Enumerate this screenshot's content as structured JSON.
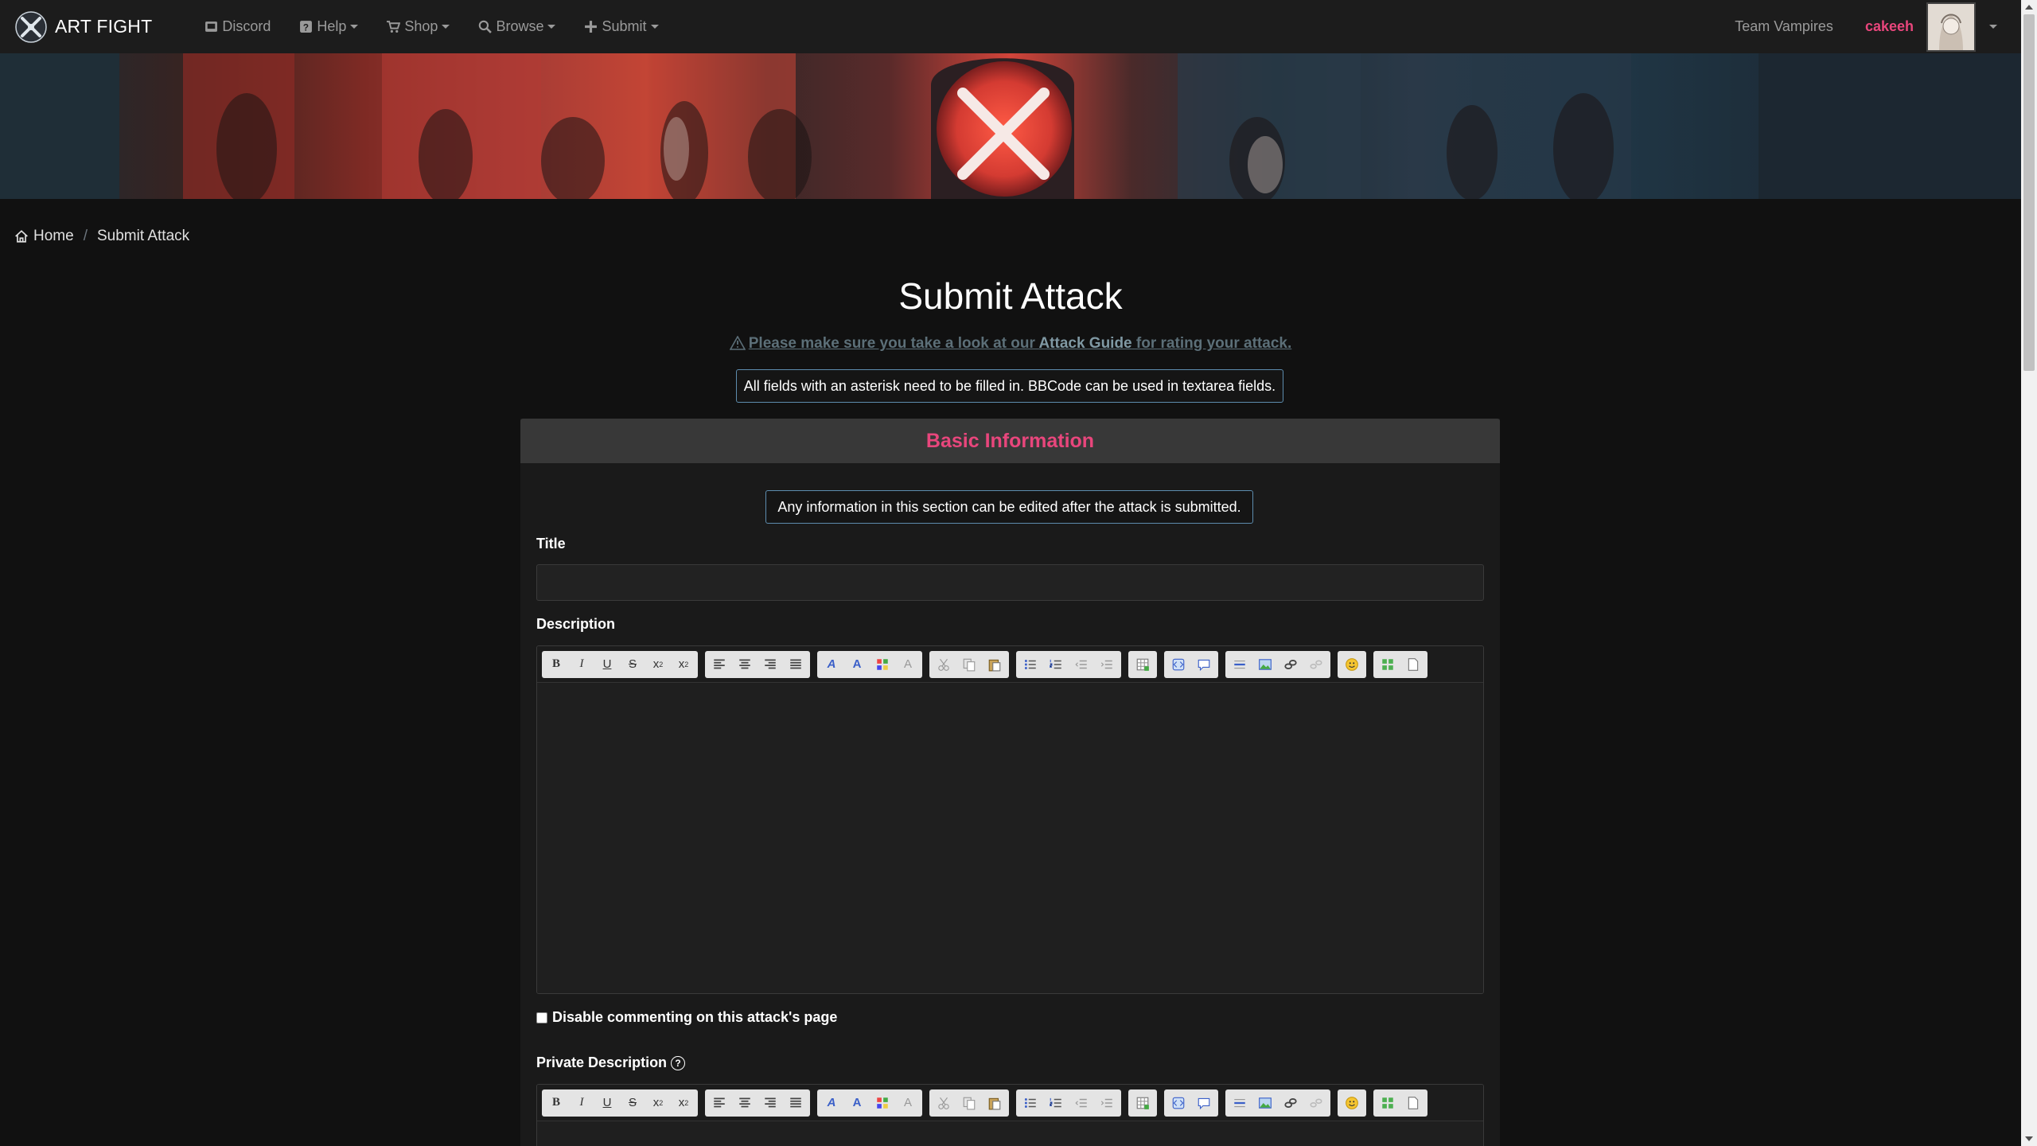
{
  "nav": {
    "brand": "ART FIGHT",
    "items": [
      {
        "label": "Discord",
        "icon": "discord-icon",
        "dropdown": false
      },
      {
        "label": "Help",
        "icon": "question-icon",
        "dropdown": true
      },
      {
        "label": "Shop",
        "icon": "cart-icon",
        "dropdown": true
      },
      {
        "label": "Browse",
        "icon": "search-icon",
        "dropdown": true
      },
      {
        "label": "Submit",
        "icon": "plus-icon",
        "dropdown": true
      }
    ],
    "team": "Team Vampires",
    "username": "cakeeh"
  },
  "breadcrumb": {
    "home": "Home",
    "current": "Submit Attack"
  },
  "page": {
    "title": "Submit Attack",
    "guide_before": "Please make sure you take a look at our ",
    "guide_link": "Attack Guide",
    "guide_after": " for rating your attack.",
    "required_note": "All fields with an asterisk need to be filled in. BBCode can be used in textarea fields."
  },
  "basic_info": {
    "header": "Basic Information",
    "info": "Any information in this section can be edited after the attack is submitted.",
    "title_label": "Title",
    "title_value": "",
    "description_label": "Description",
    "description_value": "",
    "disable_comments_label": "Disable commenting on this attack's page",
    "disable_comments_checked": false,
    "private_description_label": "Private Description",
    "private_description_value": ""
  },
  "colors": {
    "accent": "#e8467c",
    "info_border": "#5d8cae",
    "background": "#111111",
    "navbar": "#1c1c1c"
  },
  "toolbar_icons": [
    [
      "bold-icon",
      "italic-icon",
      "underline-icon",
      "strikethrough-icon",
      "subscript-icon",
      "superscript-icon"
    ],
    [
      "align-left-icon",
      "align-center-icon",
      "align-right-icon",
      "justify-icon"
    ],
    [
      "font-icon",
      "font-size-icon",
      "color-icon",
      "remove-format-icon"
    ],
    [
      "cut-icon",
      "copy-icon",
      "paste-icon"
    ],
    [
      "bullet-list-icon",
      "ordered-list-icon",
      "outdent-icon",
      "indent-icon"
    ],
    [
      "table-icon"
    ],
    [
      "code-icon",
      "quote-icon"
    ],
    [
      "horizontal-rule-icon",
      "image-icon",
      "link-icon",
      "unlink-icon"
    ],
    [
      "emoji-icon"
    ],
    [
      "maximize-icon",
      "source-icon"
    ]
  ]
}
